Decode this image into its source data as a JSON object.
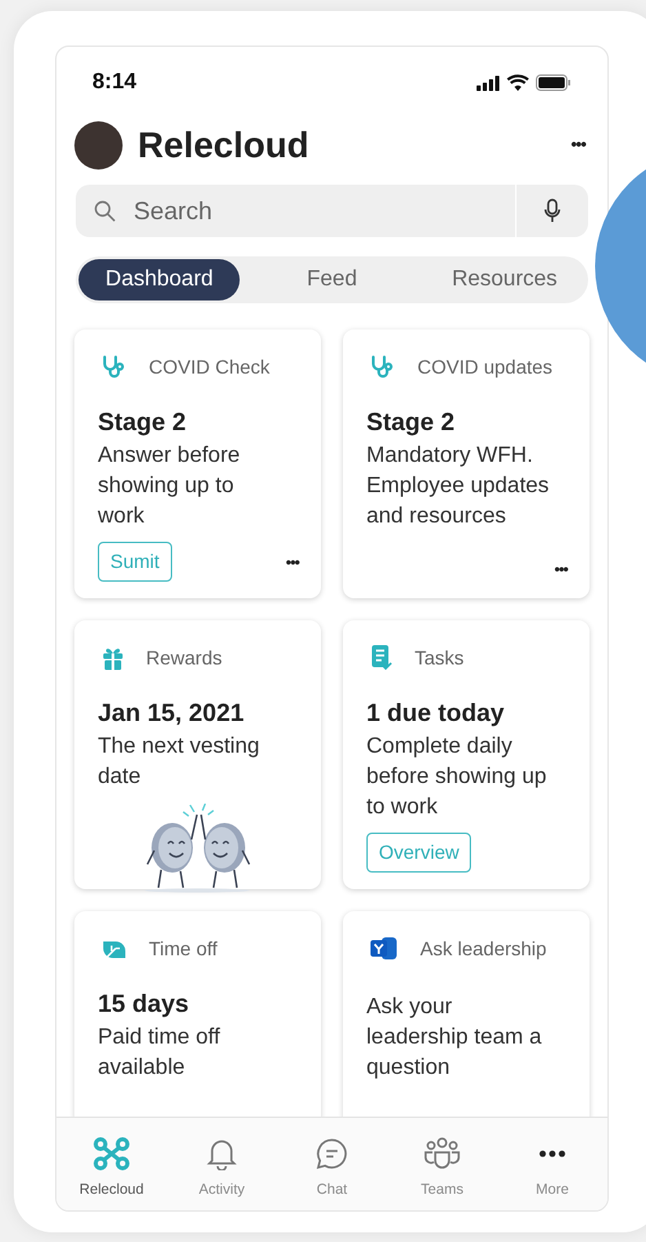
{
  "status_bar": {
    "time": "8:14"
  },
  "header": {
    "title": "Relecloud",
    "more": "•••"
  },
  "search": {
    "placeholder": "Search"
  },
  "tabs": [
    {
      "label": "Dashboard",
      "selected": true
    },
    {
      "label": "Feed",
      "selected": false
    },
    {
      "label": "Resources",
      "selected": false
    }
  ],
  "cards": [
    {
      "kind": "health",
      "label": "COVID Check",
      "title": "Stage 2",
      "body": "Answer before showing up to work",
      "button": "Sumit",
      "more": "•••",
      "illustration": false
    },
    {
      "kind": "health",
      "label": "COVID updates",
      "title": "Stage 2",
      "body": "Mandatory WFH. Employee updates and resources",
      "more": "•••",
      "illustration": false
    },
    {
      "kind": "gift",
      "label": "Rewards",
      "title": "Jan 15, 2021",
      "body": "The next vesting date",
      "illustration": true
    },
    {
      "kind": "tasks",
      "label": "Tasks",
      "title": "1 due today",
      "body": "Complete daily before showing up to work",
      "button": "Overview",
      "illustration": false
    },
    {
      "kind": "leaf",
      "label": "Time off",
      "title": "15 days",
      "body": "Paid time off available",
      "illustration": false
    },
    {
      "kind": "yammer",
      "label": "Ask leadership",
      "body": "Ask your leadership team a question",
      "illustration": false
    }
  ],
  "bottom_nav": [
    {
      "kind": "app",
      "label": "Relecloud",
      "selected": true
    },
    {
      "kind": "bell",
      "label": "Activity",
      "selected": false
    },
    {
      "kind": "chat",
      "label": "Chat",
      "selected": false
    },
    {
      "kind": "teams",
      "label": "Teams",
      "selected": false
    },
    {
      "kind": "more",
      "label": "More",
      "selected": false
    }
  ]
}
